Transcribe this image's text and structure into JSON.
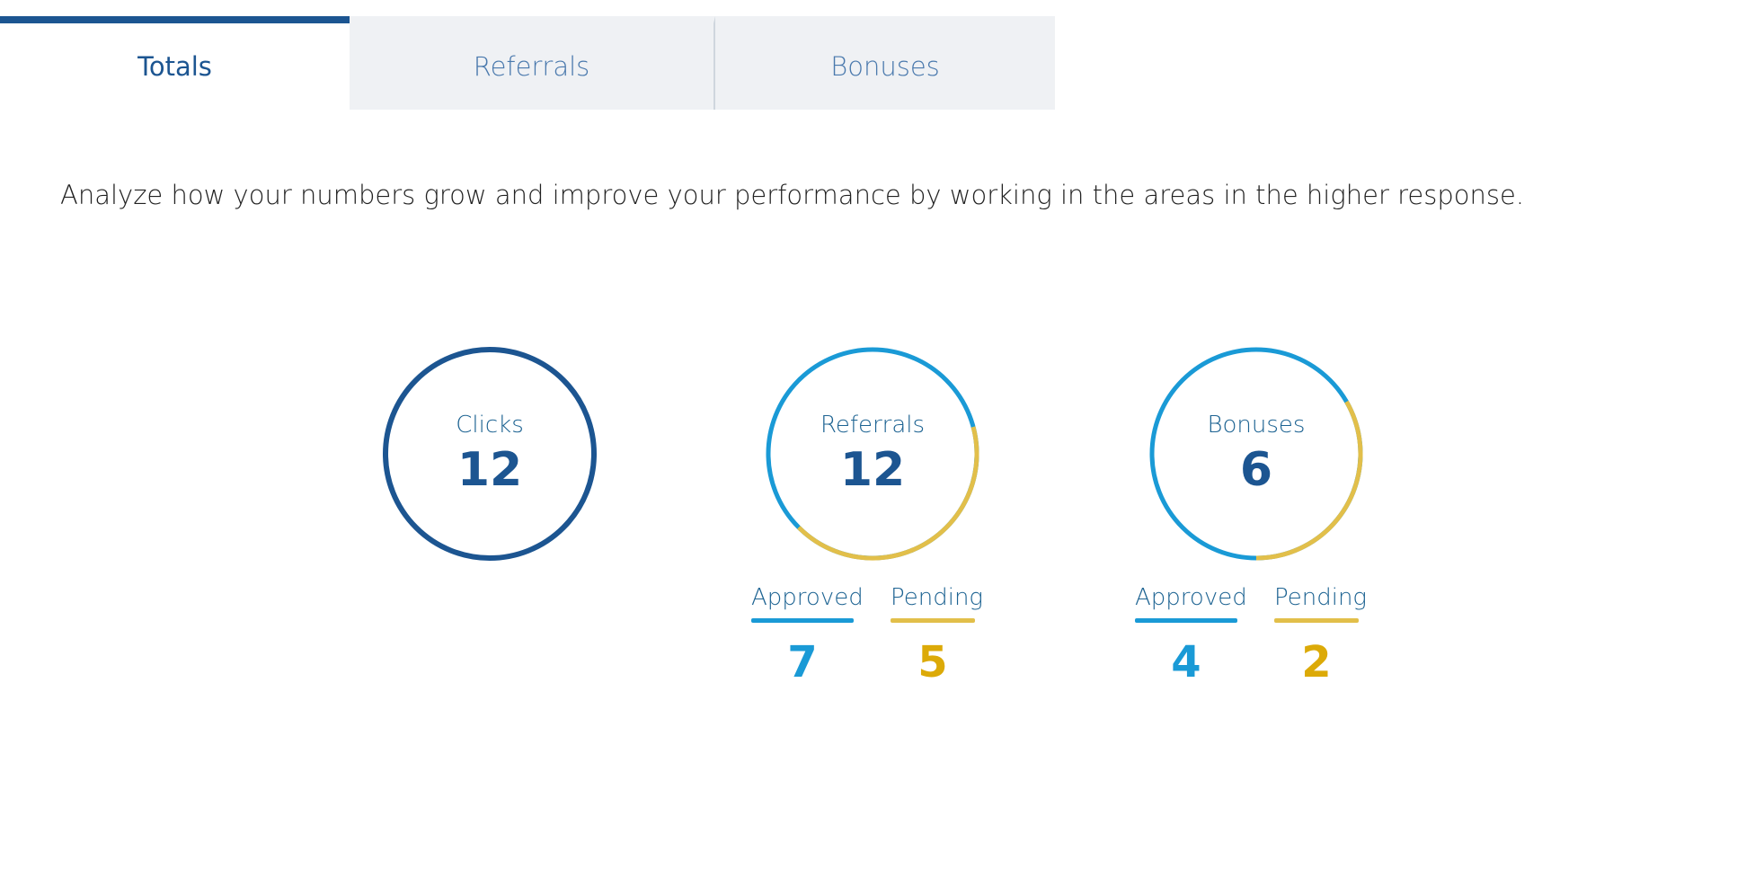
{
  "tabs": [
    {
      "label": "Totals",
      "active": true
    },
    {
      "label": "Referrals",
      "active": false
    },
    {
      "label": "Bonuses",
      "active": false
    }
  ],
  "intro_text": "Analyze how your numbers grow and improve your performance by working in the areas in the higher response.",
  "colors": {
    "navy": "#1c5591",
    "approved": "#1a9ad6",
    "pending": "#e2bf4a",
    "pending_text": "#dcaa08",
    "tab_bg": "#eff1f4"
  },
  "stats": [
    {
      "label": "Clicks",
      "value": "12"
    },
    {
      "label": "Referrals",
      "value": "12",
      "approved_label": "Approved",
      "approved_value": "7",
      "pending_label": "Pending",
      "pending_value": "5",
      "pending_fraction": 0.4167
    },
    {
      "label": "Bonuses",
      "value": "6",
      "approved_label": "Approved",
      "approved_value": "4",
      "pending_label": "Pending",
      "pending_value": "2",
      "pending_fraction": 0.3333
    }
  ]
}
